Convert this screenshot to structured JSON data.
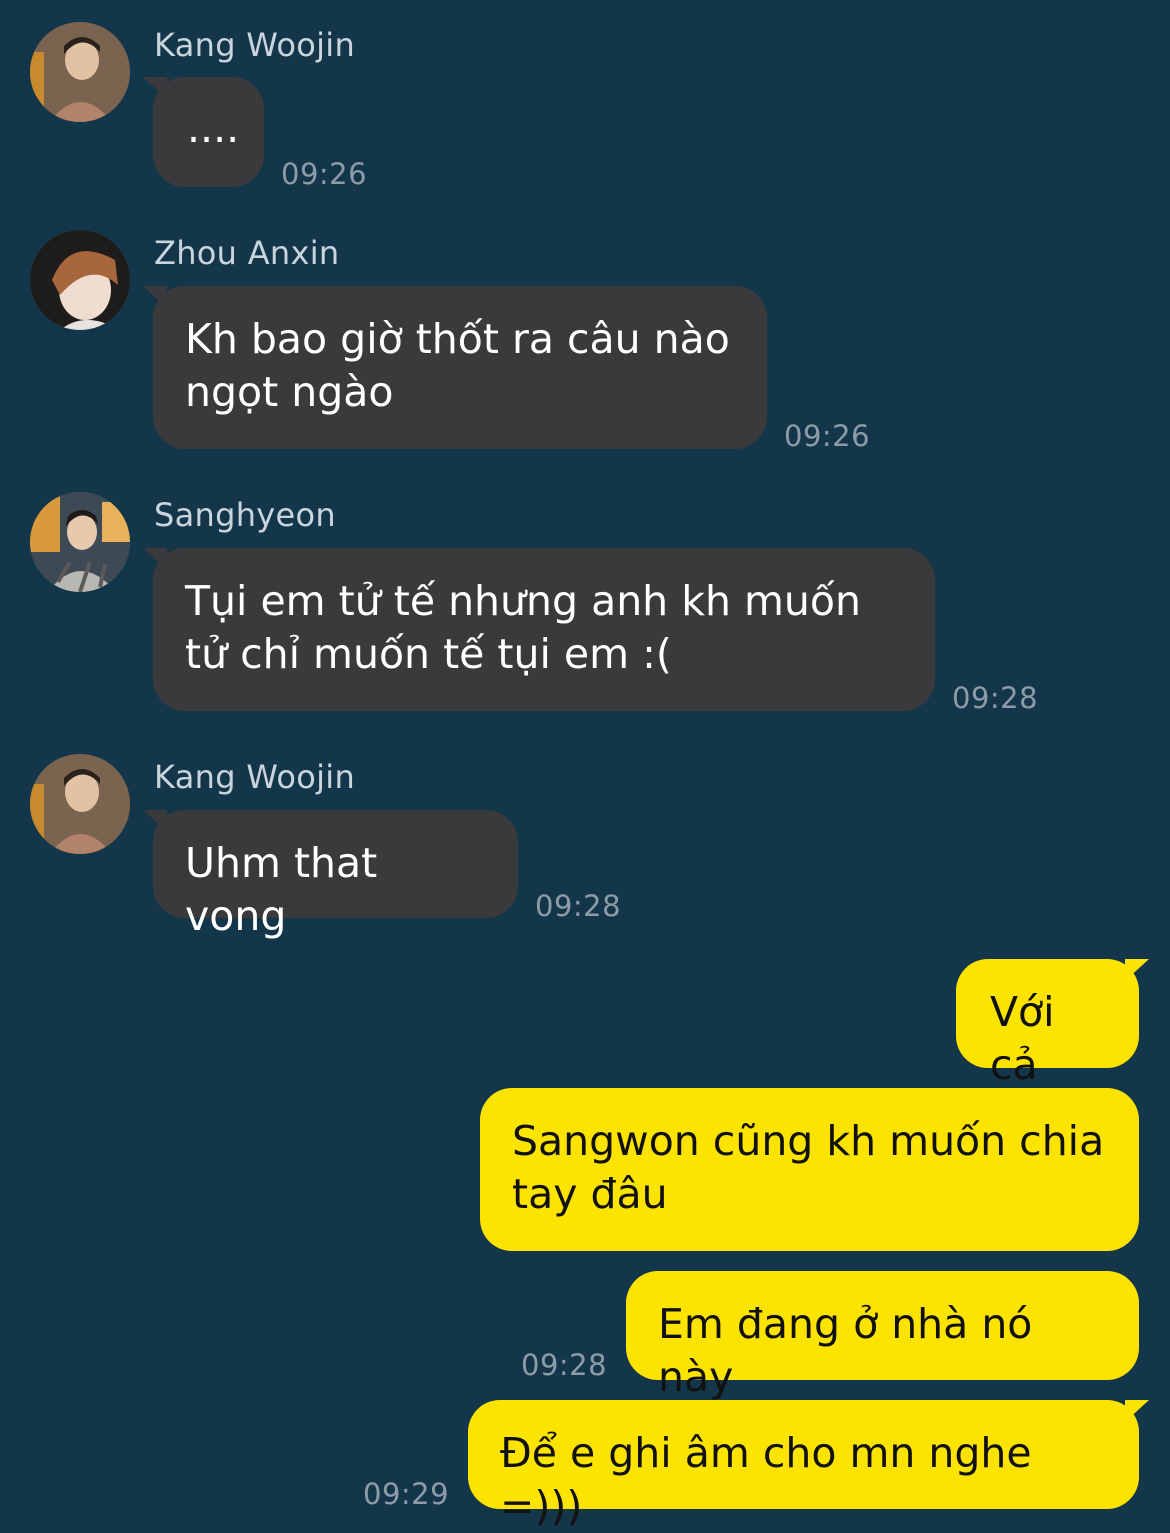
{
  "messages": [
    {
      "sender": "Kang Woojin",
      "text": "....",
      "time": "09:26",
      "avatar": "kang-woojin-avatar"
    },
    {
      "sender": "Zhou Anxin",
      "text": "Kh bao giờ thốt ra câu nào ngọt ngào",
      "time": "09:26",
      "avatar": "zhou-anxin-avatar"
    },
    {
      "sender": "Sanghyeon",
      "text": "Tụi em tử tế nhưng anh kh muốn tử chỉ muốn tế tụi em :(",
      "time": "09:28",
      "avatar": "sanghyeon-avatar"
    },
    {
      "sender": "Kang Woojin",
      "text": "Uhm that vong",
      "time": "09:28",
      "avatar": "kang-woojin-avatar"
    }
  ],
  "outgoing": [
    {
      "text": "Với cả"
    },
    {
      "text": "Sangwon cũng kh muốn chia tay đâu"
    },
    {
      "text": "Em đang ở nhà nó này",
      "time": "09:28"
    },
    {
      "text": "Để e ghi âm cho mn nghe =)))",
      "time": "09:29"
    }
  ],
  "colors": {
    "background": "#14364a",
    "incoming_bubble": "#3a3a3c",
    "outgoing_bubble": "#fde400",
    "timestamp": "#8c9ba7"
  }
}
